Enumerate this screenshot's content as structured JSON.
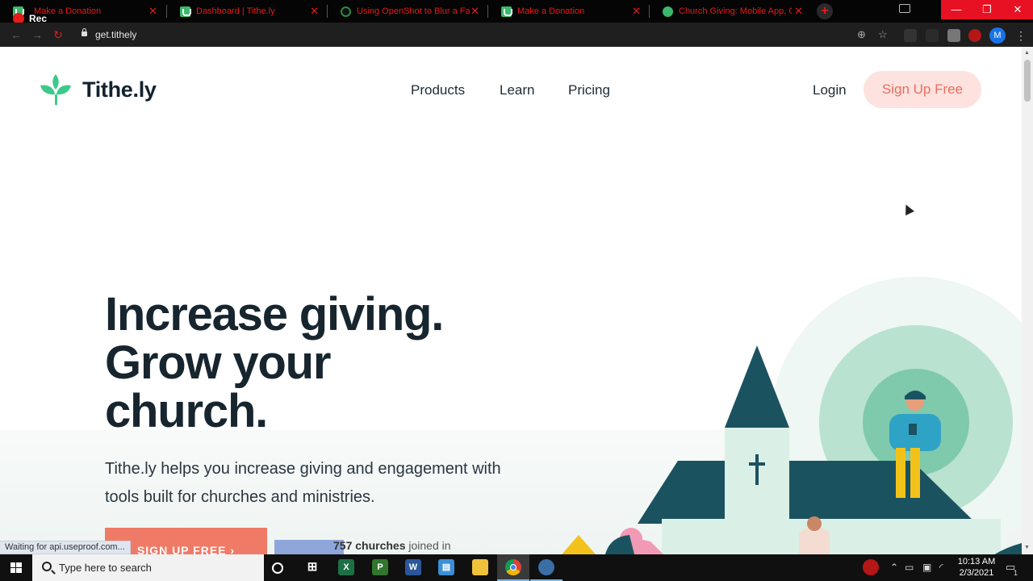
{
  "recorder": {
    "label": "Rec"
  },
  "tabs": [
    {
      "title": "Make a Donation",
      "favicon": "green-download-icon"
    },
    {
      "title": "Dashboard | Tithe.ly",
      "favicon": "green-download-icon"
    },
    {
      "title": "Using OpenShot to Blur a Face o",
      "favicon": "openshot-icon"
    },
    {
      "title": "Make a Donation",
      "favicon": "green-download-icon"
    },
    {
      "title": "Church Giving: Mobile App, Onli",
      "favicon": "tithely-icon"
    }
  ],
  "browser": {
    "url": "get.tithely",
    "window_controls": {
      "minimize": "—",
      "maximize": "❐",
      "close": "✕"
    },
    "profile_initial": "M"
  },
  "site": {
    "brand": "Tithe.ly",
    "nav": [
      "Products",
      "Learn",
      "Pricing"
    ],
    "login_label": "Login",
    "signup_label": "Sign Up Free",
    "headline": [
      "Increase giving.",
      "Grow your",
      "church."
    ],
    "subtext": "Tithe.ly helps you increase giving and engagement with tools built for churches and ministries.",
    "cta_label": "SIGN UP FREE  ›",
    "churches_count": "757 churches",
    "churches_suffix": " joined in",
    "colors": {
      "brand_green": "#3ec98b",
      "dark": "#17252f",
      "coral": "#ef6e58",
      "signup_bg": "#fde2df"
    }
  },
  "status_bar": "Waiting for api.useproof.com...",
  "taskbar": {
    "search_placeholder": "Type here to search",
    "time": "10:13 AM",
    "date": "2/3/2021",
    "notification_count": "1"
  }
}
